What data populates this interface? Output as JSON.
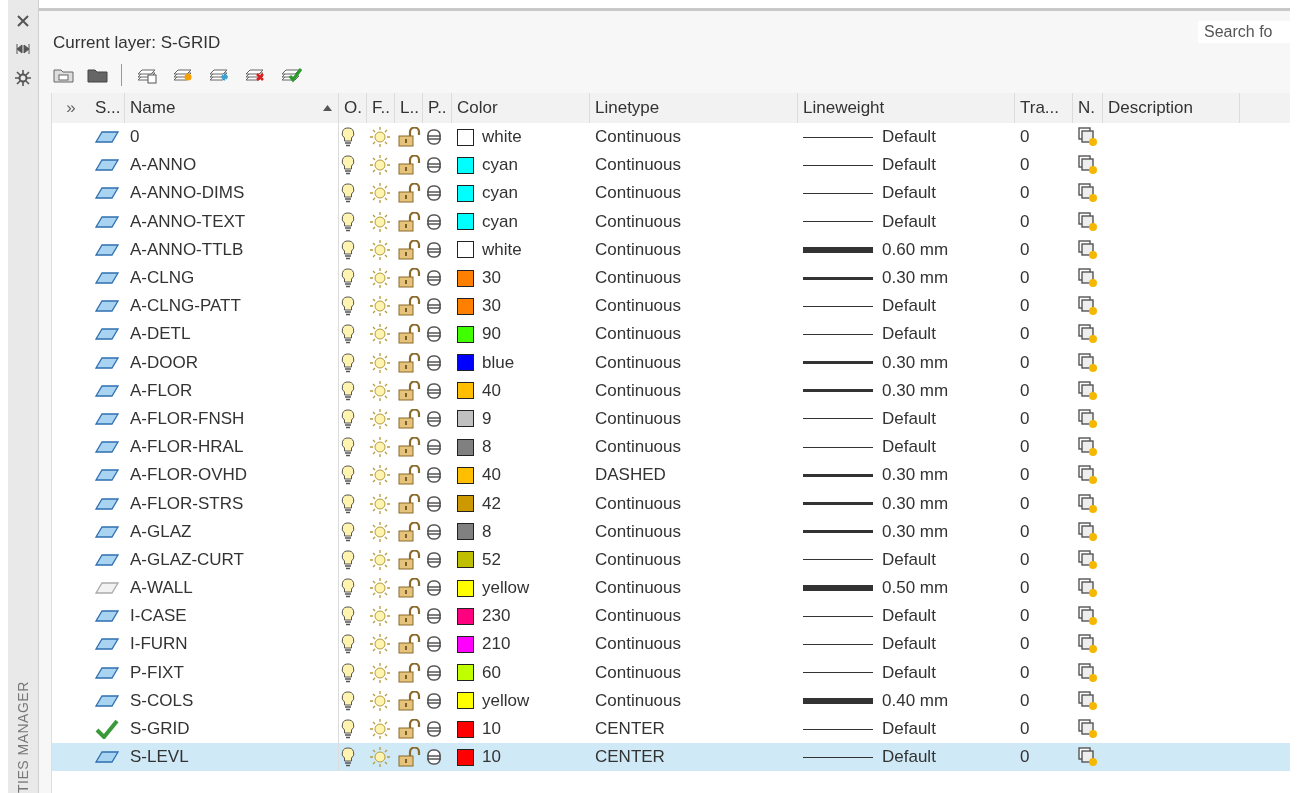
{
  "panel": {
    "side_label": "TIES MANAGER",
    "current_layer": "Current layer: S-GRID",
    "search": {
      "placeholder": "Search fo"
    }
  },
  "table": {
    "expand": "»",
    "columns": [
      {
        "label": "S...",
        "sorted": false
      },
      {
        "label": "Name",
        "sorted": true
      },
      {
        "label": "O.",
        "sorted": false
      },
      {
        "label": "F..",
        "sorted": false
      },
      {
        "label": "L..",
        "sorted": false
      },
      {
        "label": "P..",
        "sorted": false
      },
      {
        "label": "Color",
        "sorted": false
      },
      {
        "label": "Linetype",
        "sorted": false
      },
      {
        "label": "Lineweight",
        "sorted": false
      },
      {
        "label": "Tra...",
        "sorted": false
      },
      {
        "label": "N.",
        "sorted": false
      },
      {
        "label": "Description",
        "sorted": false
      }
    ],
    "rows": [
      {
        "kind": "layer",
        "name": "0",
        "selected": false,
        "on": true,
        "frozen": false,
        "locked": false,
        "plot": true,
        "color": "#ffffff",
        "color_name": "white",
        "linetype": "Continuous",
        "lineweight": {
          "kind": "thin",
          "text": "Default"
        },
        "transparency": "0"
      },
      {
        "kind": "layer",
        "name": "A-ANNO",
        "selected": false,
        "on": true,
        "frozen": false,
        "locked": false,
        "plot": true,
        "color": "#00ffff",
        "color_name": "cyan",
        "linetype": "Continuous",
        "lineweight": {
          "kind": "thin",
          "text": "Default"
        },
        "transparency": "0"
      },
      {
        "kind": "layer",
        "name": "A-ANNO-DIMS",
        "selected": false,
        "on": true,
        "frozen": false,
        "locked": false,
        "plot": true,
        "color": "#00ffff",
        "color_name": "cyan",
        "linetype": "Continuous",
        "lineweight": {
          "kind": "thin",
          "text": "Default"
        },
        "transparency": "0"
      },
      {
        "kind": "layer",
        "name": "A-ANNO-TEXT",
        "selected": false,
        "on": true,
        "frozen": false,
        "locked": false,
        "plot": true,
        "color": "#00ffff",
        "color_name": "cyan",
        "linetype": "Continuous",
        "lineweight": {
          "kind": "thin",
          "text": "Default"
        },
        "transparency": "0"
      },
      {
        "kind": "layer",
        "name": "A-ANNO-TTLB",
        "selected": false,
        "on": true,
        "frozen": false,
        "locked": false,
        "plot": true,
        "color": "#ffffff",
        "color_name": "white",
        "linetype": "Continuous",
        "lineweight": {
          "kind": "heavy",
          "text": "0.60 mm"
        },
        "transparency": "0"
      },
      {
        "kind": "layer",
        "name": "A-CLNG",
        "selected": false,
        "on": true,
        "frozen": false,
        "locked": false,
        "plot": true,
        "color": "#ff7f00",
        "color_name": "30",
        "linetype": "Continuous",
        "lineweight": {
          "kind": "medium",
          "text": "0.30 mm"
        },
        "transparency": "0"
      },
      {
        "kind": "layer",
        "name": "A-CLNG-PATT",
        "selected": false,
        "on": true,
        "frozen": false,
        "locked": false,
        "plot": true,
        "color": "#ff7f00",
        "color_name": "30",
        "linetype": "Continuous",
        "lineweight": {
          "kind": "thin",
          "text": "Default"
        },
        "transparency": "0"
      },
      {
        "kind": "layer",
        "name": "A-DETL",
        "selected": false,
        "on": true,
        "frozen": false,
        "locked": false,
        "plot": true,
        "color": "#3fff00",
        "color_name": "90",
        "linetype": "Continuous",
        "lineweight": {
          "kind": "thin",
          "text": "Default"
        },
        "transparency": "0"
      },
      {
        "kind": "layer",
        "name": "A-DOOR",
        "selected": false,
        "on": true,
        "frozen": false,
        "locked": false,
        "plot": true,
        "color": "#0000ff",
        "color_name": "blue",
        "linetype": "Continuous",
        "lineweight": {
          "kind": "medium",
          "text": "0.30 mm"
        },
        "transparency": "0"
      },
      {
        "kind": "layer",
        "name": "A-FLOR",
        "selected": false,
        "on": true,
        "frozen": false,
        "locked": false,
        "plot": true,
        "color": "#ffbf00",
        "color_name": "40",
        "linetype": "Continuous",
        "lineweight": {
          "kind": "medium",
          "text": "0.30 mm"
        },
        "transparency": "0"
      },
      {
        "kind": "layer",
        "name": "A-FLOR-FNSH",
        "selected": false,
        "on": true,
        "frozen": false,
        "locked": false,
        "plot": true,
        "color": "#c0c0c0",
        "color_name": "9",
        "linetype": "Continuous",
        "lineweight": {
          "kind": "thin",
          "text": "Default"
        },
        "transparency": "0"
      },
      {
        "kind": "layer",
        "name": "A-FLOR-HRAL",
        "selected": false,
        "on": true,
        "frozen": false,
        "locked": false,
        "plot": true,
        "color": "#808080",
        "color_name": "8",
        "linetype": "Continuous",
        "lineweight": {
          "kind": "thin",
          "text": "Default"
        },
        "transparency": "0"
      },
      {
        "kind": "layer",
        "name": "A-FLOR-OVHD",
        "selected": false,
        "on": true,
        "frozen": false,
        "locked": false,
        "plot": true,
        "color": "#ffbf00",
        "color_name": "40",
        "linetype": "DASHED",
        "lineweight": {
          "kind": "medium",
          "text": "0.30 mm"
        },
        "transparency": "0"
      },
      {
        "kind": "layer",
        "name": "A-FLOR-STRS",
        "selected": false,
        "on": true,
        "frozen": false,
        "locked": false,
        "plot": true,
        "color": "#cc9900",
        "color_name": "42",
        "linetype": "Continuous",
        "lineweight": {
          "kind": "medium",
          "text": "0.30 mm"
        },
        "transparency": "0"
      },
      {
        "kind": "layer",
        "name": "A-GLAZ",
        "selected": false,
        "on": true,
        "frozen": false,
        "locked": false,
        "plot": true,
        "color": "#808080",
        "color_name": "8",
        "linetype": "Continuous",
        "lineweight": {
          "kind": "medium",
          "text": "0.30 mm"
        },
        "transparency": "0"
      },
      {
        "kind": "layer",
        "name": "A-GLAZ-CURT",
        "selected": false,
        "on": true,
        "frozen": false,
        "locked": false,
        "plot": true,
        "color": "#bfbf00",
        "color_name": "52",
        "linetype": "Continuous",
        "lineweight": {
          "kind": "thin",
          "text": "Default"
        },
        "transparency": "0"
      },
      {
        "kind": "unused",
        "name": "A-WALL",
        "selected": false,
        "on": true,
        "frozen": false,
        "locked": false,
        "plot": true,
        "color": "#ffff00",
        "color_name": "yellow",
        "linetype": "Continuous",
        "lineweight": {
          "kind": "heavy",
          "text": "0.50 mm"
        },
        "transparency": "0"
      },
      {
        "kind": "layer",
        "name": "I-CASE",
        "selected": false,
        "on": true,
        "frozen": false,
        "locked": false,
        "plot": true,
        "color": "#ff007f",
        "color_name": "230",
        "linetype": "Continuous",
        "lineweight": {
          "kind": "thin",
          "text": "Default"
        },
        "transparency": "0"
      },
      {
        "kind": "layer",
        "name": "I-FURN",
        "selected": false,
        "on": true,
        "frozen": false,
        "locked": false,
        "plot": true,
        "color": "#ff00ff",
        "color_name": "210",
        "linetype": "Continuous",
        "lineweight": {
          "kind": "thin",
          "text": "Default"
        },
        "transparency": "0"
      },
      {
        "kind": "layer",
        "name": "P-FIXT",
        "selected": false,
        "on": true,
        "frozen": false,
        "locked": false,
        "plot": true,
        "color": "#bfff00",
        "color_name": "60",
        "linetype": "Continuous",
        "lineweight": {
          "kind": "thin",
          "text": "Default"
        },
        "transparency": "0"
      },
      {
        "kind": "layer",
        "name": "S-COLS",
        "selected": false,
        "on": true,
        "frozen": false,
        "locked": false,
        "plot": true,
        "color": "#ffff00",
        "color_name": "yellow",
        "linetype": "Continuous",
        "lineweight": {
          "kind": "heavy",
          "text": "0.40 mm"
        },
        "transparency": "0"
      },
      {
        "kind": "current",
        "name": "S-GRID",
        "selected": false,
        "on": true,
        "frozen": false,
        "locked": false,
        "plot": true,
        "color": "#ff0000",
        "color_name": "10",
        "linetype": "CENTER",
        "lineweight": {
          "kind": "thin",
          "text": "Default"
        },
        "transparency": "0"
      },
      {
        "kind": "layer",
        "name": "S-LEVL",
        "selected": true,
        "on": true,
        "frozen": false,
        "locked": false,
        "plot": true,
        "color": "#ff0000",
        "color_name": "10",
        "linetype": "CENTER",
        "lineweight": {
          "kind": "thin",
          "text": "Default"
        },
        "transparency": "0"
      }
    ]
  }
}
